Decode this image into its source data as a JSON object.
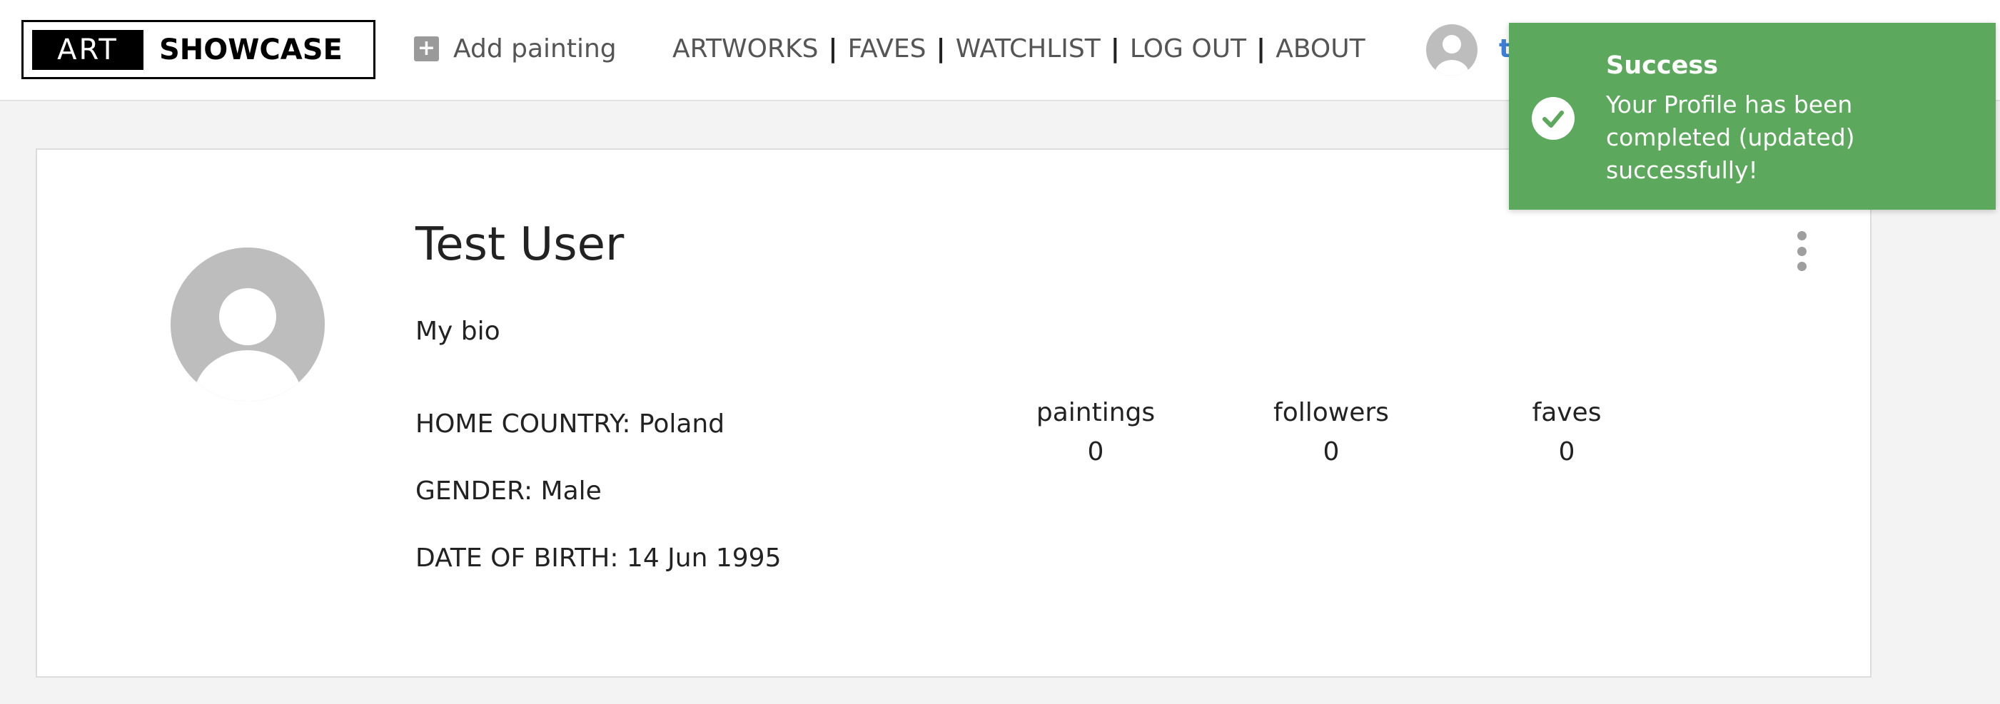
{
  "header": {
    "logo_left": "ART",
    "logo_right": "SHOWCASE",
    "add_painting_label": "Add painting",
    "nav": [
      "ARTWORKS",
      "FAVES",
      "WATCHLIST",
      "LOG OUT",
      "ABOUT"
    ],
    "nav_separator": "|",
    "username": "test-user"
  },
  "profile": {
    "name": "Test User",
    "bio": "My bio",
    "home_country": "HOME COUNTRY: Poland",
    "gender": "GENDER: Male",
    "date_of_birth": "DATE OF BIRTH: 14 Jun 1995",
    "stats": [
      {
        "label": "paintings",
        "value": "0"
      },
      {
        "label": "followers",
        "value": "0"
      },
      {
        "label": "faves",
        "value": "0"
      }
    ]
  },
  "toast": {
    "title": "Success",
    "message": "Your Profile has been completed (updated) successfully!",
    "color": "#5ca85c"
  },
  "icons": {
    "add": "plus-icon",
    "avatar": "user-avatar-icon",
    "menu": "kebab-menu-icon",
    "success": "check-circle-icon"
  },
  "colors": {
    "username": "#3d7fd6",
    "nav_text": "#555555",
    "page_bg": "#f3f3f3"
  }
}
